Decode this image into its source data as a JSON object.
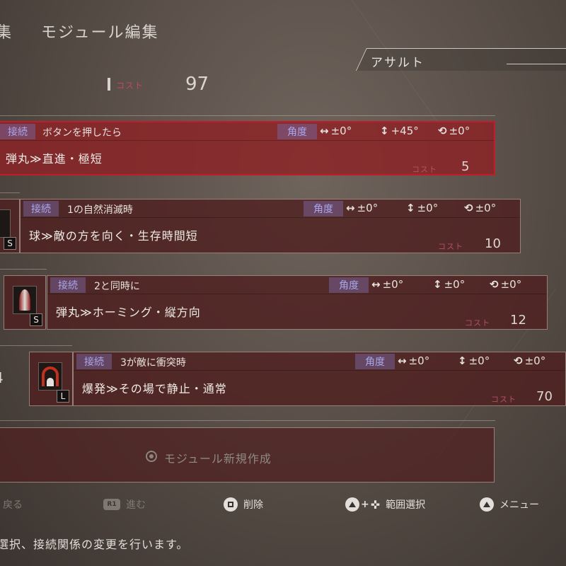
{
  "header": {
    "prev_tab_fragment": "集",
    "title": "モジュール編集"
  },
  "preset": {
    "name": "アサルト"
  },
  "total_cost": {
    "label": "コスト",
    "value": "97"
  },
  "labels": {
    "connect": "接続",
    "angle": "角度",
    "cost": "コスト"
  },
  "modules": [
    {
      "condition": "ボタンを押したら",
      "angle_h": "±0°",
      "angle_v": "+45°",
      "angle_r": "±0°",
      "name": "弾丸≫直進・極短",
      "cost": "5",
      "selected": true
    },
    {
      "condition": "1の自然消滅時",
      "angle_h": "±0°",
      "angle_v": "±0°",
      "angle_r": "±0°",
      "name": "球≫敵の方を向く・生存時間短",
      "cost": "10",
      "size": "S"
    },
    {
      "condition": "2と同時に",
      "angle_h": "±0°",
      "angle_v": "±0°",
      "angle_r": "±0°",
      "name": "弾丸≫ホーミング・縦方向",
      "cost": "12",
      "size": "S"
    },
    {
      "index": "4",
      "condition": "3が敵に衝突時",
      "angle_h": "±0°",
      "angle_v": "±0°",
      "angle_r": "±0°",
      "name": "爆発≫その場で静止・通常",
      "cost": "70",
      "size": "L"
    }
  ],
  "new_module": {
    "label": "モジュール新規作成"
  },
  "controls": {
    "back": "戻る",
    "next_button": "R1",
    "next": "進む",
    "delete": "削除",
    "range_select": "範囲選択",
    "menu": "メニュー"
  },
  "footer": {
    "text": "選択、接続関係の変更を行います。"
  },
  "colors": {
    "selected_border": "#c01d2a",
    "badge_text": "#a9a6ea",
    "cost_label": "#c2485a"
  },
  "icons": {
    "horizontal": "↔",
    "vertical": "↕",
    "rotate": "⟲"
  }
}
